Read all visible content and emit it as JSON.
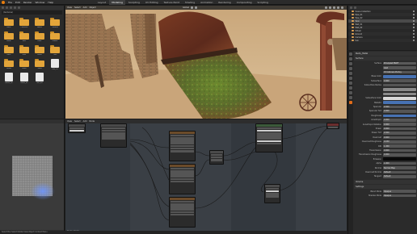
{
  "topbar": {
    "menus": [
      "File",
      "Edit",
      "Render",
      "Window",
      "Help"
    ],
    "tabs": [
      "Layout",
      "Modeling",
      "Sculpting",
      "UV Editing",
      "Texture Paint",
      "Shading",
      "Animation",
      "Rendering",
      "Compositing",
      "Scripting"
    ],
    "active_tab_index": 1
  },
  "filebrowser": {
    "path": "/textures/",
    "items": [
      {
        "type": "folder",
        "label": "Brick"
      },
      {
        "type": "folder",
        "label": "Concrete"
      },
      {
        "type": "folder",
        "label": "Fabric"
      },
      {
        "type": "folder",
        "label": "Ground"
      },
      {
        "type": "folder",
        "label": "Metal"
      },
      {
        "type": "folder",
        "label": "Misc"
      },
      {
        "type": "folder",
        "label": "Paint"
      },
      {
        "type": "folder",
        "label": "Plaster"
      },
      {
        "type": "folder",
        "label": "Rock"
      },
      {
        "type": "folder",
        "label": "Rust"
      },
      {
        "type": "folder",
        "label": "Stone"
      },
      {
        "type": "folder",
        "label": "Tiles"
      },
      {
        "type": "folder",
        "label": "Wood"
      },
      {
        "type": "folder",
        "label": "Moss"
      },
      {
        "type": "folder",
        "label": "Sand"
      },
      {
        "type": "file",
        "label": "rust_01"
      },
      {
        "type": "file",
        "label": "metal_02"
      },
      {
        "type": "file",
        "label": "moss_03"
      },
      {
        "type": "file",
        "label": "dirt_04"
      }
    ]
  },
  "viewport": {
    "header_left": [
      "View",
      "Select",
      "Add",
      "Object"
    ],
    "mode": "Object Mode",
    "shading": "Global"
  },
  "outliner": {
    "rows": [
      {
        "label": "Scene Collection",
        "selected": false
      },
      {
        "label": "Pipe_01",
        "selected": false
      },
      {
        "label": "Pipe_02",
        "selected": false
      },
      {
        "label": "Tank",
        "selected": true
      },
      {
        "label": "Wall_01",
        "selected": false
      },
      {
        "label": "Wall_02",
        "selected": false
      },
      {
        "label": "Wheel",
        "selected": false
      },
      {
        "label": "Ground",
        "selected": false
      },
      {
        "label": "Camera",
        "selected": false
      },
      {
        "label": "Sun",
        "selected": false
      }
    ]
  },
  "properties": {
    "material_name": "Rusty_Metal",
    "section": "Surface",
    "rows": [
      {
        "k": "Surface",
        "v": "Principled BSDF",
        "style": "accent"
      },
      {
        "k": "",
        "v": "GGX",
        "style": ""
      },
      {
        "k": "",
        "v": "Christensen-Burley",
        "style": ""
      },
      {
        "k": "Base Color",
        "v": "",
        "style": "blue"
      },
      {
        "k": "Subsurface",
        "v": "0.000",
        "style": ""
      },
      {
        "k": "Subsurface Radius",
        "v": "",
        "style": ""
      },
      {
        "k": "",
        "v": "",
        "style": "gray"
      },
      {
        "k": "",
        "v": "",
        "style": "gray"
      },
      {
        "k": "Subsurface Color",
        "v": "",
        "style": "white"
      },
      {
        "k": "Metallic",
        "v": "",
        "style": "blue"
      },
      {
        "k": "Specular",
        "v": "0.500",
        "style": ""
      },
      {
        "k": "Specular Tint",
        "v": "0.000",
        "style": ""
      },
      {
        "k": "Roughness",
        "v": "",
        "style": "blue"
      },
      {
        "k": "Anisotropic",
        "v": "0.000",
        "style": ""
      },
      {
        "k": "Anisotropic Rotation",
        "v": "0.000",
        "style": ""
      },
      {
        "k": "Sheen",
        "v": "0.000",
        "style": ""
      },
      {
        "k": "Sheen Tint",
        "v": "0.500",
        "style": ""
      },
      {
        "k": "Clearcoat",
        "v": "0.000",
        "style": ""
      },
      {
        "k": "Clearcoat Roughness",
        "v": "0.030",
        "style": ""
      },
      {
        "k": "IOR",
        "v": "1.450",
        "style": ""
      },
      {
        "k": "Transmission",
        "v": "0.000",
        "style": ""
      },
      {
        "k": "Transmission Roughness",
        "v": "0.000",
        "style": ""
      },
      {
        "k": "Emission",
        "v": "",
        "style": "black"
      },
      {
        "k": "Alpha",
        "v": "1.000",
        "style": ""
      },
      {
        "k": "Normal",
        "v": "Normal Map",
        "style": ""
      },
      {
        "k": "Clearcoat Normal",
        "v": "Default",
        "style": ""
      },
      {
        "k": "Tangent",
        "v": "Default",
        "style": ""
      }
    ],
    "footer_sections": [
      "Volume",
      "Settings"
    ],
    "footer_rows": [
      {
        "k": "Blend Mode",
        "v": "Opaque"
      },
      {
        "k": "Shadow Mode",
        "v": "Opaque"
      }
    ]
  },
  "nodeeditor": {
    "header": [
      "View",
      "Select",
      "Add",
      "Node"
    ],
    "footer_text": "Rusty_Metal"
  },
  "statusbar": {
    "text": "Select   Box Select   Rotate View   Object Context Menu"
  }
}
